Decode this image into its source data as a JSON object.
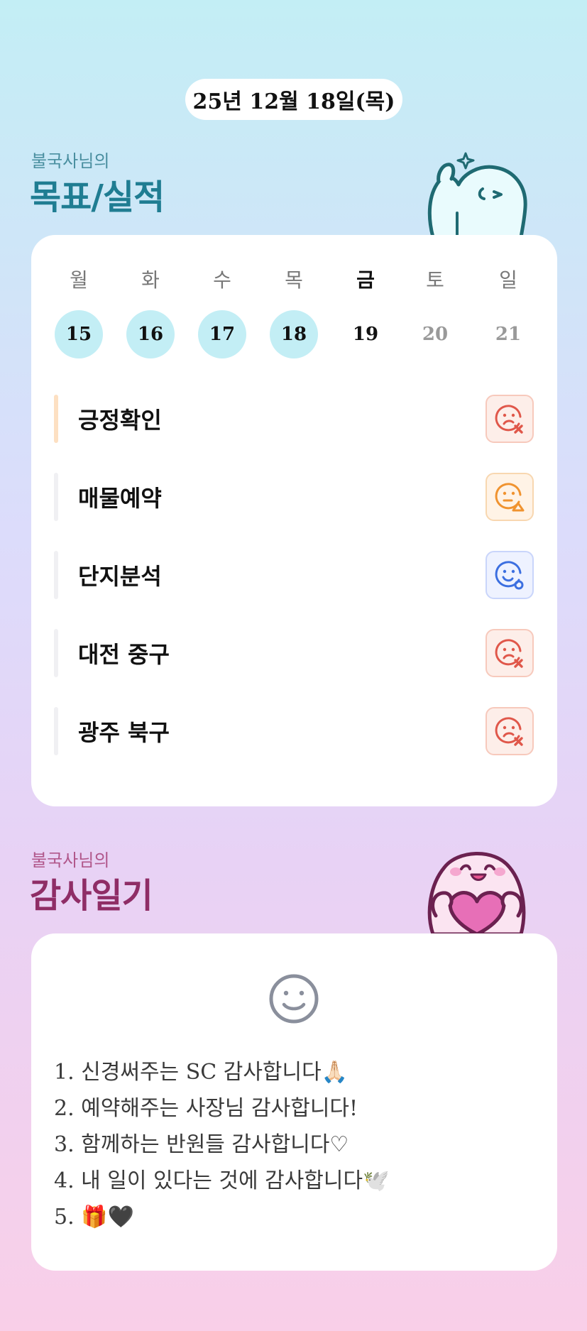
{
  "date_label": "25년 12월 18일(목)",
  "goals_section": {
    "subtitle": "불국사님의",
    "title": "목표/실적"
  },
  "week": [
    {
      "name": "월",
      "num": "15",
      "state": "done"
    },
    {
      "name": "화",
      "num": "16",
      "state": "done"
    },
    {
      "name": "수",
      "num": "17",
      "state": "done"
    },
    {
      "name": "목",
      "num": "18",
      "state": "done"
    },
    {
      "name": "금",
      "num": "19",
      "state": "today"
    },
    {
      "name": "토",
      "num": "20",
      "state": "future"
    },
    {
      "name": "일",
      "num": "21",
      "state": "future"
    }
  ],
  "goals": [
    {
      "label": "긍정확인",
      "status": "fail",
      "status_icon": "sad-x-face-icon"
    },
    {
      "label": "매물예약",
      "status": "warn",
      "status_icon": "neutral-triangle-face-icon"
    },
    {
      "label": "단지분석",
      "status": "ok",
      "status_icon": "smile-o-face-icon"
    },
    {
      "label": "대전 중구",
      "status": "fail",
      "status_icon": "sad-x-face-icon"
    },
    {
      "label": "광주 북구",
      "status": "fail",
      "status_icon": "sad-x-face-icon"
    }
  ],
  "gratitude_section": {
    "subtitle": "불국사님의",
    "title": "감사일기"
  },
  "gratitude_lines": [
    "1. 신경써주는 SC 감사합니다🙏🏻",
    "2. 예약해주는 사장님 감사합니다!",
    "3. 함께하는 반원들 감사합니다♡",
    "4. 내 일이 있다는 것에 감사합니다🕊️",
    "5. 🎁🖤"
  ],
  "colors": {
    "done_day": "#c3eef5",
    "fail": "#e0574a",
    "warn": "#f0932f",
    "ok": "#3c6fe0",
    "goals_title": "#1f7d92",
    "gratitude_title": "#8f2d66"
  }
}
